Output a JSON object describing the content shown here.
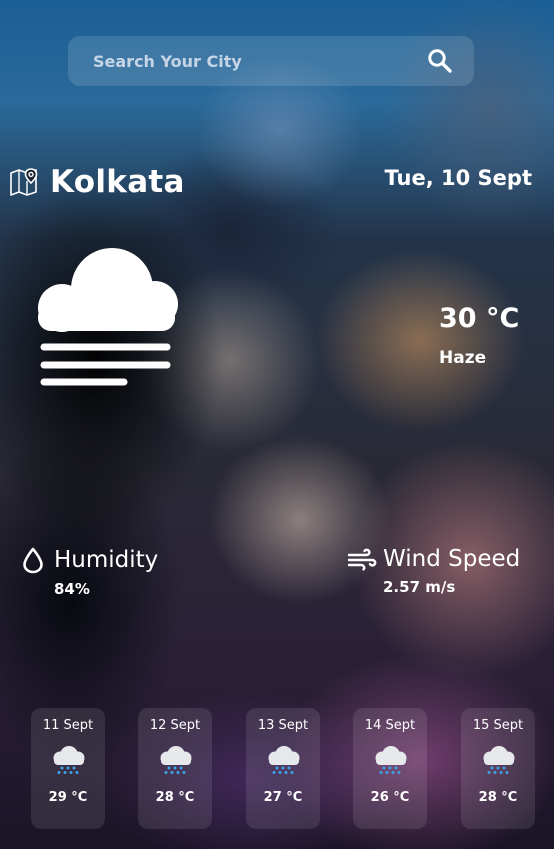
{
  "search": {
    "placeholder": "Search Your City",
    "icon": "search-icon"
  },
  "location": {
    "icon": "map-pin-icon",
    "city": "Kolkata"
  },
  "date": "Tue, 10 Sept",
  "current": {
    "icon": "haze-icon",
    "temperature": "30 °C",
    "condition": "Haze"
  },
  "stats": {
    "humidity": {
      "icon": "droplet-icon",
      "label": "Humidity",
      "value": "84%"
    },
    "wind": {
      "icon": "wind-icon",
      "label": "Wind Speed",
      "value": "2.57 m/s"
    }
  },
  "forecast": [
    {
      "date": "11 Sept",
      "icon": "rain-cloud-icon",
      "temp": "29 °C"
    },
    {
      "date": "12 Sept",
      "icon": "rain-cloud-icon",
      "temp": "28 °C"
    },
    {
      "date": "13 Sept",
      "icon": "rain-cloud-icon",
      "temp": "27 °C"
    },
    {
      "date": "14 Sept",
      "icon": "rain-cloud-icon",
      "temp": "26 °C"
    },
    {
      "date": "15 Sept",
      "icon": "rain-cloud-icon",
      "temp": "28 °C"
    }
  ],
  "colors": {
    "text": "#ffffff",
    "rain_drops": "#3fa2e8",
    "cloud": "#e6e8ec"
  }
}
